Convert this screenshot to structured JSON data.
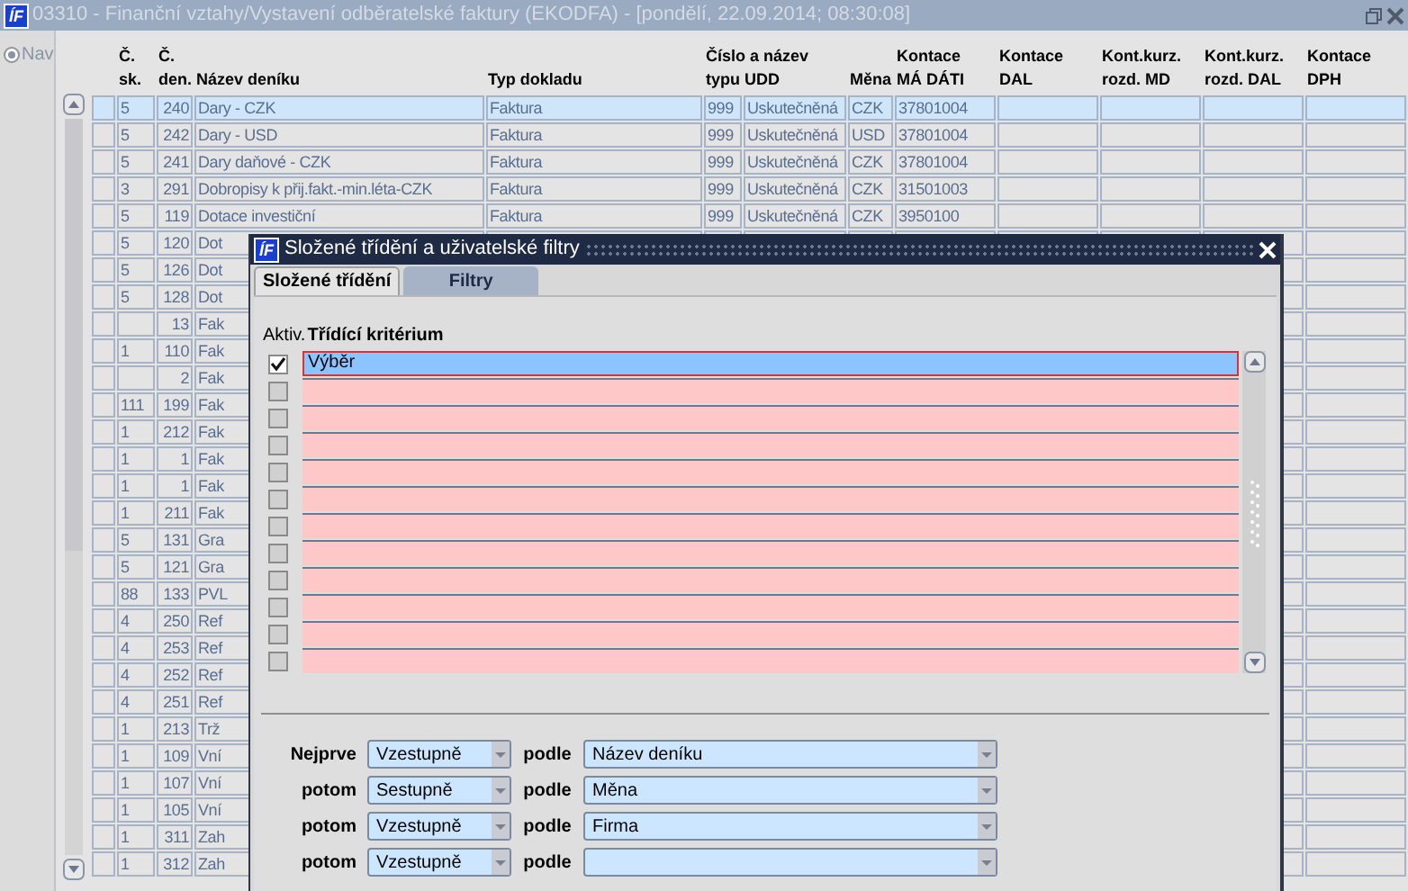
{
  "window": {
    "logo": "ÍF",
    "title": "03310 - Finanční vztahy/Vystavení odběratelské faktury (EKODFA) - [pondělí, 22.09.2014; 08:30:08]"
  },
  "nav": {
    "label": "Nav",
    "selected": true
  },
  "table": {
    "columns": [
      "Č.\nsk.",
      "Č.\nden.",
      "Název deníku",
      "Typ dokladu",
      "Číslo a název\ntypu UDD",
      "Měna",
      "Kontace\nMÁ DÁTI",
      "Kontace\nDAL",
      "Kont.kurz.\nrozd. MD",
      "Kont.kurz.\nrozd. DAL",
      "Kontace\nDPH"
    ],
    "rows": [
      {
        "selected": true,
        "cells": [
          "5",
          "240",
          "Dary - CZK",
          "Faktura",
          {
            "number": "999",
            "name": "Uskutečněná"
          },
          "CZK",
          "37801004"
        ]
      },
      {
        "selected": false,
        "cells": [
          "5",
          "242",
          "Dary - USD",
          "Faktura",
          {
            "number": "999",
            "name": "Uskutečněná"
          },
          "USD",
          "37801004"
        ]
      },
      {
        "selected": false,
        "cells": [
          "5",
          "241",
          "Dary daňové - CZK",
          "Faktura",
          {
            "number": "999",
            "name": "Uskutečněná"
          },
          "CZK",
          "37801004"
        ]
      },
      {
        "selected": false,
        "cells": [
          "3",
          "291",
          "Dobropisy k přij.fakt.-min.léta-CZK",
          "Faktura",
          {
            "number": "999",
            "name": "Uskutečněná"
          },
          "CZK",
          "31501003"
        ]
      },
      {
        "selected": false,
        "cells": [
          "5",
          "119",
          "Dotace investiční",
          "Faktura",
          {
            "number": "999",
            "name": "Uskutečněná"
          },
          "CZK",
          "3950100"
        ]
      },
      {
        "selected": false,
        "cells": [
          "5",
          "120",
          "Dot"
        ]
      },
      {
        "selected": false,
        "cells": [
          "5",
          "126",
          "Dot"
        ]
      },
      {
        "selected": false,
        "cells": [
          "5",
          "128",
          "Dot"
        ]
      },
      {
        "selected": false,
        "cells": [
          "",
          "13",
          "Fak"
        ]
      },
      {
        "selected": false,
        "cells": [
          "1",
          "110",
          "Fak"
        ]
      },
      {
        "selected": false,
        "cells": [
          "",
          "2",
          "Fak"
        ]
      },
      {
        "selected": false,
        "cells": [
          "111",
          "199",
          "Fak"
        ]
      },
      {
        "selected": false,
        "cells": [
          "1",
          "212",
          "Fak"
        ]
      },
      {
        "selected": false,
        "cells": [
          "1",
          "1",
          "Fak"
        ]
      },
      {
        "selected": false,
        "cells": [
          "1",
          "1",
          "Fak"
        ]
      },
      {
        "selected": false,
        "cells": [
          "1",
          "211",
          "Fak"
        ]
      },
      {
        "selected": false,
        "cells": [
          "5",
          "131",
          "Gra"
        ]
      },
      {
        "selected": false,
        "cells": [
          "5",
          "121",
          "Gra"
        ]
      },
      {
        "selected": false,
        "cells": [
          "88",
          "133",
          "PVL"
        ]
      },
      {
        "selected": false,
        "cells": [
          "4",
          "250",
          "Ref"
        ]
      },
      {
        "selected": false,
        "cells": [
          "4",
          "253",
          "Ref"
        ]
      },
      {
        "selected": false,
        "cells": [
          "4",
          "252",
          "Ref"
        ]
      },
      {
        "selected": false,
        "cells": [
          "4",
          "251",
          "Ref"
        ]
      },
      {
        "selected": false,
        "cells": [
          "1",
          "213",
          "Trž"
        ]
      },
      {
        "selected": false,
        "cells": [
          "1",
          "109",
          "Vní"
        ]
      },
      {
        "selected": false,
        "cells": [
          "1",
          "107",
          "Vní"
        ]
      },
      {
        "selected": false,
        "cells": [
          "1",
          "105",
          "Vní"
        ]
      },
      {
        "selected": false,
        "cells": [
          "1",
          "311",
          "Zah"
        ]
      },
      {
        "selected": false,
        "cells": [
          "1",
          "312",
          "Zah"
        ]
      }
    ]
  },
  "dialog": {
    "logo": "ÍF",
    "title": "Složené třídění a uživatelské filtry",
    "tabs": [
      {
        "label": "Složené třídění",
        "selected": true
      },
      {
        "label": "Filtry",
        "selected": false
      }
    ],
    "criteria_header": {
      "active": "Aktiv.",
      "criterion": "Třídící kritérium"
    },
    "criteria": [
      {
        "active": true,
        "selected": true,
        "value": "Výběr"
      },
      {
        "active": false,
        "selected": false
      },
      {
        "active": false,
        "selected": false
      },
      {
        "active": false,
        "selected": false
      },
      {
        "active": false,
        "selected": false
      },
      {
        "active": false,
        "selected": false
      },
      {
        "active": false,
        "selected": false
      },
      {
        "active": false,
        "selected": false
      },
      {
        "active": false,
        "selected": false
      },
      {
        "active": false,
        "selected": false
      },
      {
        "active": false,
        "selected": false
      },
      {
        "active": false,
        "selected": false
      }
    ],
    "sort": [
      {
        "label": "Nejprve",
        "direction": "Vzestupně",
        "by": "podle",
        "field": "Název deníku"
      },
      {
        "label": "potom",
        "direction": "Sestupně",
        "by": "podle",
        "field": "Měna"
      },
      {
        "label": "potom",
        "direction": "Vzestupně",
        "by": "podle",
        "field": "Firma"
      },
      {
        "label": "potom",
        "direction": "Vzestupně",
        "by": "podle"
      }
    ]
  }
}
